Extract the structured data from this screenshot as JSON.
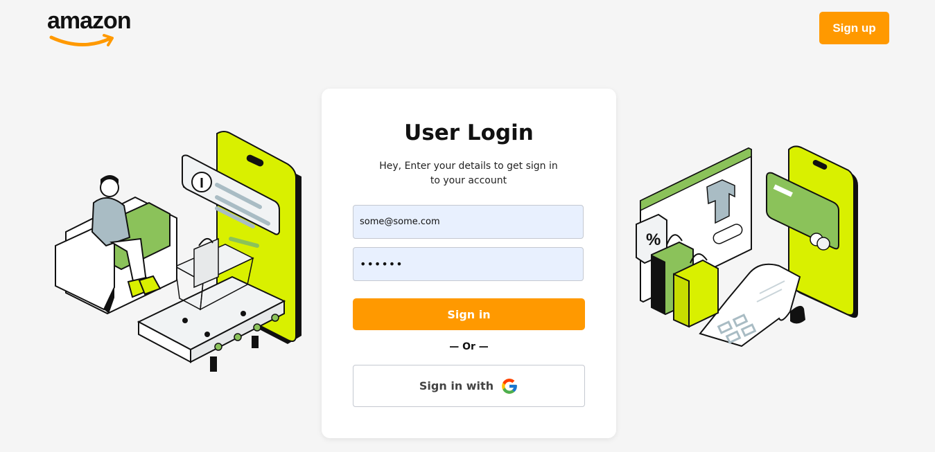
{
  "brand": {
    "logo_text": "amazon",
    "accent": "#ff9900"
  },
  "header": {
    "signup_label": "Sign up"
  },
  "login": {
    "title": "User Login",
    "subtitle_line1": "Hey, Enter your details to get sign in",
    "subtitle_line2": "to your account",
    "email_value": "some@some.com",
    "password_value": "••••••",
    "signin_label": "Sign in",
    "divider_text": "— Or —",
    "google_label": "Sign in with",
    "google_icon": "google-g-icon"
  },
  "colors": {
    "background": "#f5f5f5",
    "lime": "#d9f000",
    "green": "#8bc25a",
    "input_bg": "#e8f0fe"
  }
}
